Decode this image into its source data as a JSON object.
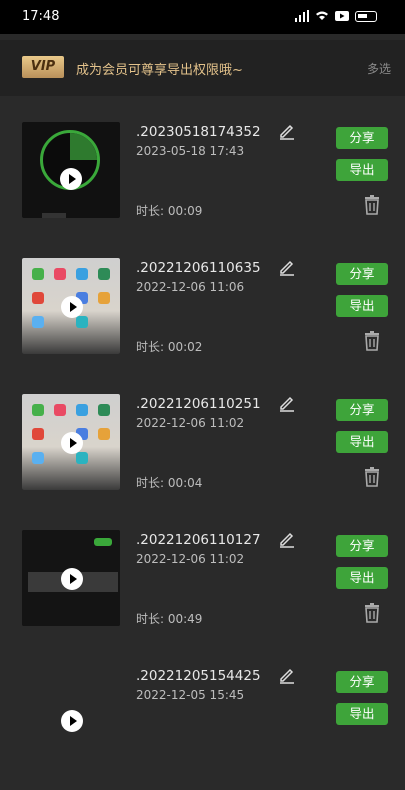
{
  "status_bar": {
    "time": "17:48"
  },
  "vip": {
    "badge": "VIP",
    "text": "成为会员可尊享导出权限哦~",
    "multi_select": "多选"
  },
  "buttons": {
    "share": "分享",
    "export": "导出"
  },
  "recordings": [
    {
      "title": ".20230518174352",
      "date": "2023-05-18 17:43",
      "duration": "时长: 00:09"
    },
    {
      "title": ".20221206110635",
      "date": "2022-12-06 11:06",
      "duration": "时长: 00:02"
    },
    {
      "title": ".20221206110251",
      "date": "2022-12-06 11:02",
      "duration": "时长: 00:04"
    },
    {
      "title": ".20221206110127",
      "date": "2022-12-06 11:02",
      "duration": "时长: 00:49"
    },
    {
      "title": ".20221205154425",
      "date": "2022-12-05 15:45",
      "duration": ""
    }
  ]
}
